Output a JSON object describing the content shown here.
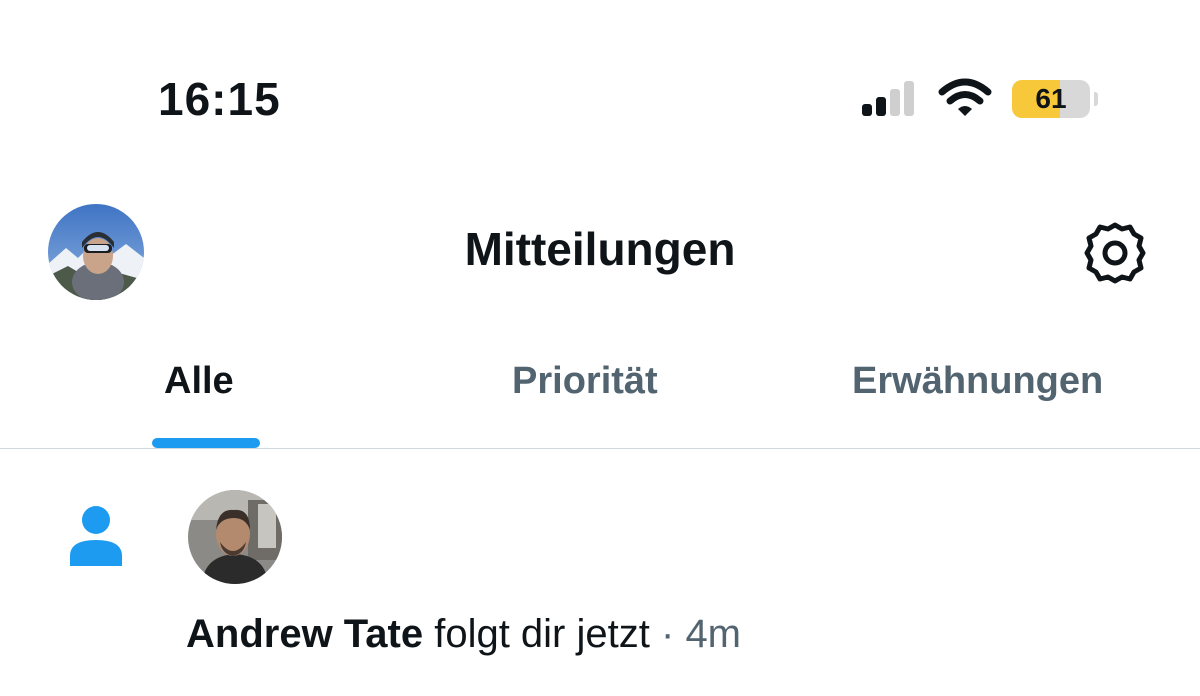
{
  "status_bar": {
    "time": "16:15",
    "battery_level": 61,
    "battery_text": "61",
    "battery_color": "#f7c93a",
    "signal_bars_active": 2,
    "signal_bars_total": 4
  },
  "header": {
    "title": "Mitteilungen",
    "avatar_icon": "profile-avatar",
    "settings_icon": "gear-icon"
  },
  "tabs": [
    {
      "label": "Alle",
      "active": true
    },
    {
      "label": "Priorität",
      "active": false
    },
    {
      "label": "Erwähnungen",
      "active": false
    }
  ],
  "accent_color": "#1d9bf0",
  "notifications": [
    {
      "type_icon": "person-icon",
      "user_name": "Andrew Tate",
      "action": "folgt dir jetzt",
      "separator": "·",
      "time": "4m"
    }
  ]
}
